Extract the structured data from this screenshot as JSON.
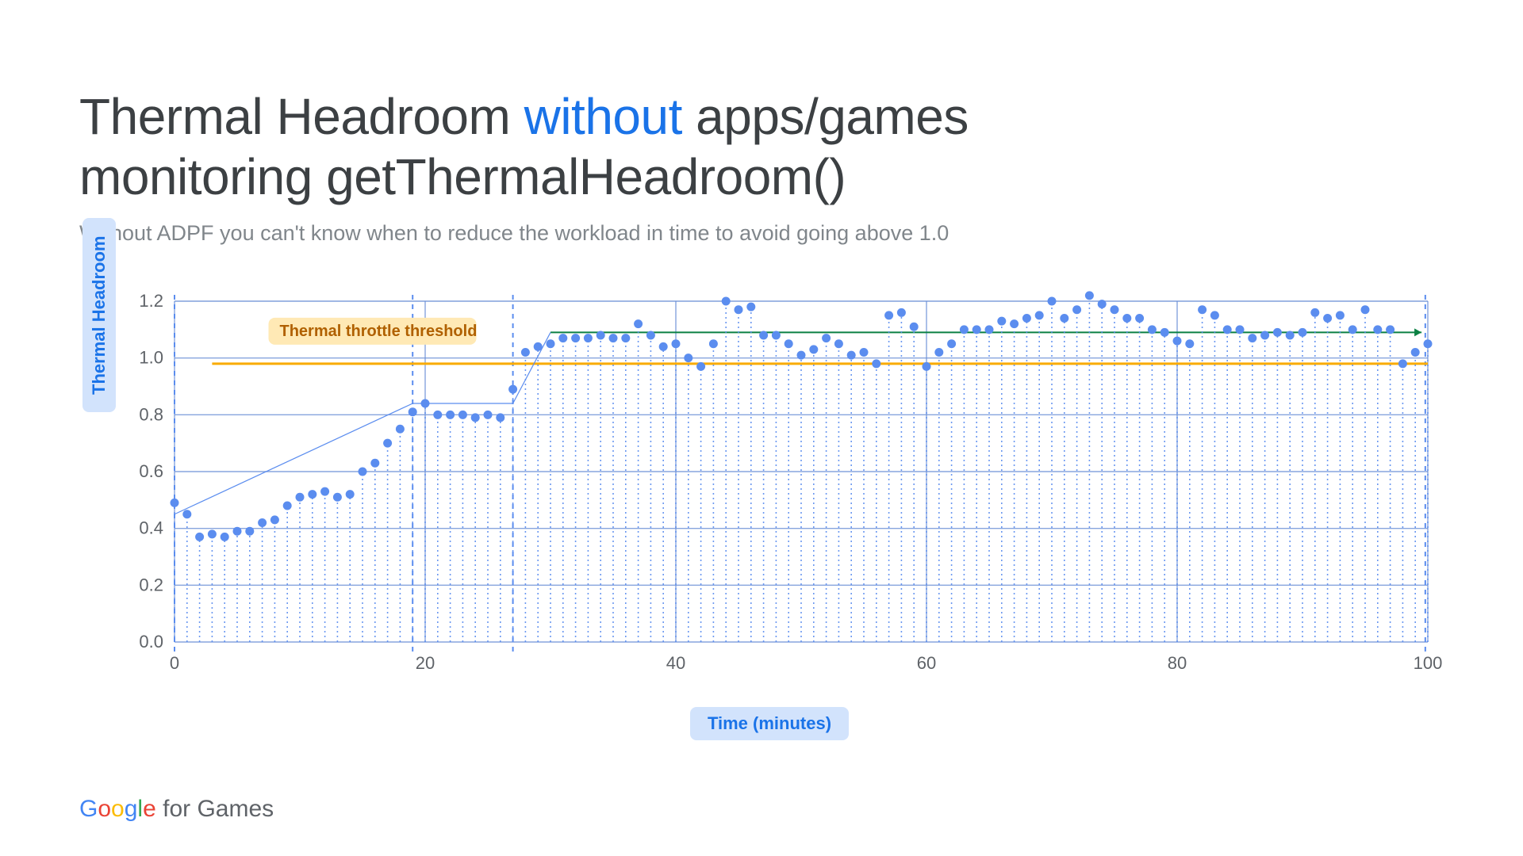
{
  "title_part1": "Thermal Headroom ",
  "title_accent": "without",
  "title_part2": " apps/games",
  "title_line2": "monitoring getThermalHeadroom()",
  "subtitle": "Without ADPF you can't know when to reduce the workload in time to avoid going above 1.0",
  "yaxis_label": "Thermal Headroom",
  "xaxis_label": "Time (minutes)",
  "threshold_annotation": "Thermal throttle threshold",
  "footer_brand_suffix": " for Games",
  "chart_data": {
    "type": "scatter",
    "xlabel": "Time (minutes)",
    "ylabel": "Thermal Headroom",
    "xlim": [
      0,
      100
    ],
    "ylim": [
      0,
      1.2
    ],
    "xticks": [
      0,
      20,
      40,
      60,
      80,
      100
    ],
    "yticks": [
      0.0,
      0.2,
      0.4,
      0.6,
      0.8,
      1.0,
      1.2
    ],
    "threshold_line_y": 0.98,
    "trend_line_y": 1.09,
    "vertical_dashed_x": [
      0,
      19,
      27,
      99.8
    ],
    "plateau_segments": [
      {
        "x0": 0,
        "y0": 0.45,
        "x1": 19,
        "y1": 0.84
      },
      {
        "x0": 19,
        "y0": 0.84,
        "x1": 27,
        "y1": 0.84
      },
      {
        "x0": 27,
        "y0": 0.84,
        "x1": 30,
        "y1": 1.09
      }
    ],
    "series": [
      {
        "name": "thermal_headroom",
        "x": [
          0,
          1,
          2,
          3,
          4,
          5,
          6,
          7,
          8,
          9,
          10,
          11,
          12,
          13,
          14,
          15,
          16,
          17,
          18,
          19,
          20,
          21,
          22,
          23,
          24,
          25,
          26,
          27,
          28,
          29,
          30,
          31,
          32,
          33,
          34,
          35,
          36,
          37,
          38,
          39,
          40,
          41,
          42,
          43,
          44,
          45,
          46,
          47,
          48,
          49,
          50,
          51,
          52,
          53,
          54,
          55,
          56,
          57,
          58,
          59,
          60,
          61,
          62,
          63,
          64,
          65,
          66,
          67,
          68,
          69,
          70,
          71,
          72,
          73,
          74,
          75,
          76,
          77,
          78,
          79,
          80,
          81,
          82,
          83,
          84,
          85,
          86,
          87,
          88,
          89,
          90,
          91,
          92,
          93,
          94,
          95,
          96,
          97,
          98,
          99,
          100
        ],
        "y": [
          0.49,
          0.45,
          0.37,
          0.38,
          0.37,
          0.39,
          0.39,
          0.42,
          0.43,
          0.48,
          0.51,
          0.52,
          0.53,
          0.51,
          0.52,
          0.6,
          0.63,
          0.7,
          0.75,
          0.81,
          0.84,
          0.8,
          0.8,
          0.8,
          0.79,
          0.8,
          0.79,
          0.89,
          1.02,
          1.04,
          1.05,
          1.07,
          1.07,
          1.07,
          1.08,
          1.07,
          1.07,
          1.12,
          1.08,
          1.04,
          1.05,
          1.0,
          0.97,
          1.05,
          1.2,
          1.17,
          1.18,
          1.08,
          1.08,
          1.05,
          1.01,
          1.03,
          1.07,
          1.05,
          1.01,
          1.02,
          0.98,
          1.15,
          1.16,
          1.11,
          0.97,
          1.02,
          1.05,
          1.1,
          1.1,
          1.1,
          1.13,
          1.12,
          1.14,
          1.15,
          1.2,
          1.14,
          1.17,
          1.22,
          1.19,
          1.17,
          1.14,
          1.14,
          1.1,
          1.09,
          1.06,
          1.05,
          1.17,
          1.15,
          1.1,
          1.1,
          1.07,
          1.08,
          1.09,
          1.08,
          1.09,
          1.16,
          1.14,
          1.15,
          1.1,
          1.17,
          1.1,
          1.1,
          0.98,
          1.02,
          1.05
        ]
      }
    ]
  }
}
